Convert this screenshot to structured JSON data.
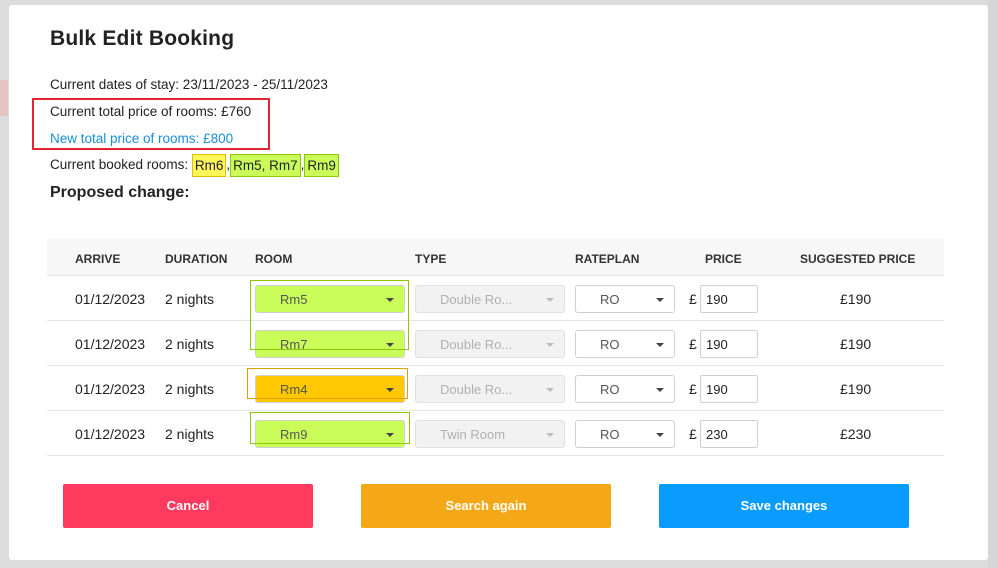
{
  "modal": {
    "title": "Bulk Edit Booking",
    "current_dates": "Current dates of stay: 23/11/2023 - 25/11/2023",
    "current_total": "Current total price of rooms: £760",
    "new_total": "New total price of rooms: £800",
    "booked_rooms_label": "Current booked rooms: ",
    "booked_rooms": [
      "Rm6",
      "Rm5, Rm7",
      "Rm9"
    ],
    "booked_rooms_sep": ",",
    "proposed_change": "Proposed change:"
  },
  "table": {
    "headers": {
      "arrive": "ARRIVE",
      "duration": "DURATION",
      "room": "ROOM",
      "type": "TYPE",
      "rateplan": "RATEPLAN",
      "price": "PRICE",
      "suggested": "SUGGESTED PRICE"
    },
    "rows": [
      {
        "arrive": "01/12/2023",
        "duration": "2 nights",
        "room": "Rm5",
        "type": "Double Ro...",
        "rateplan": "RO",
        "currency": "£",
        "price": "190",
        "suggested": "£190"
      },
      {
        "arrive": "01/12/2023",
        "duration": "2 nights",
        "room": "Rm7",
        "type": "Double Ro...",
        "rateplan": "RO",
        "currency": "£",
        "price": "190",
        "suggested": "£190"
      },
      {
        "arrive": "01/12/2023",
        "duration": "2 nights",
        "room": "Rm4",
        "type": "Double Ro...",
        "rateplan": "RO",
        "currency": "£",
        "price": "190",
        "suggested": "£190"
      },
      {
        "arrive": "01/12/2023",
        "duration": "2 nights",
        "room": "Rm9",
        "type": "Twin Room",
        "rateplan": "RO",
        "currency": "£",
        "price": "230",
        "suggested": "£230"
      }
    ]
  },
  "buttons": {
    "cancel": "Cancel",
    "search_again": "Search again",
    "save_changes": "Save changes"
  },
  "colors": {
    "highlight_green": "#cbfd5a",
    "highlight_yellow": "#fff65a",
    "highlight_orange": "#ffc800",
    "annotation_red": "#e0262e",
    "cancel": "#ff3a5e",
    "search": "#f5a817",
    "save": "#0a9bff",
    "link_blue": "#1a8fd6"
  },
  "icons": {
    "select_caret": "chevron-down-icon"
  }
}
